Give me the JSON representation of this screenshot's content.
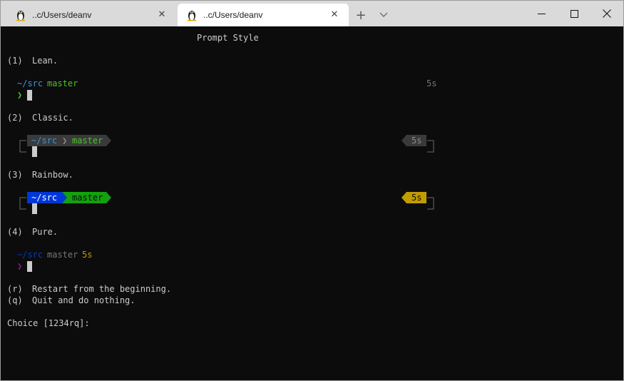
{
  "tabs": [
    {
      "title": "..c/Users/deanv",
      "close": "✕",
      "active": false
    },
    {
      "title": "..c/Users/deanv",
      "close": "✕",
      "active": true
    }
  ],
  "titlebar": {
    "new_tab": "+",
    "dropdown_icon": "chevron-down-icon"
  },
  "window_controls": {
    "minimize": "minimize-icon",
    "maximize": "maximize-icon",
    "close": "close-icon"
  },
  "terminal": {
    "heading": "Prompt Style",
    "options": [
      {
        "number": "(1)",
        "name": "Lean."
      },
      {
        "number": "(2)",
        "name": "Classic."
      },
      {
        "number": "(3)",
        "name": "Rainbow."
      },
      {
        "number": "(4)",
        "name": "Pure."
      }
    ],
    "lean": {
      "dir": "~/src",
      "branch": "master",
      "duration": "5s",
      "prompt_char": "❯"
    },
    "classic": {
      "dir": "~/src",
      "separator": "❯",
      "branch": "master",
      "duration": "5s"
    },
    "rainbow": {
      "dir": "~/src",
      "branch": "master",
      "duration": "5s"
    },
    "pure": {
      "dir": "~/src",
      "branch": "master",
      "duration": "5s",
      "prompt_char": "❯"
    },
    "actions": [
      {
        "key": "(r)",
        "text": "Restart from the beginning."
      },
      {
        "key": "(q)",
        "text": "Quit and do nothing."
      }
    ],
    "choice_prompt": "Choice [1234rq]:"
  },
  "colors": {
    "background": "#0c0c0c",
    "foreground": "#cccccc",
    "dir_blue": "#3a96dd",
    "branch_green": "#4ec12a",
    "classic_bg": "#3a3a3a",
    "rainbow_blue": "#0037da",
    "rainbow_green": "#13a10e",
    "duration_yellow": "#c19c00",
    "pure_dir": "#0037da",
    "pure_branch": "#767676",
    "pure_prompt": "#881798",
    "lean_duration": "#767676"
  }
}
